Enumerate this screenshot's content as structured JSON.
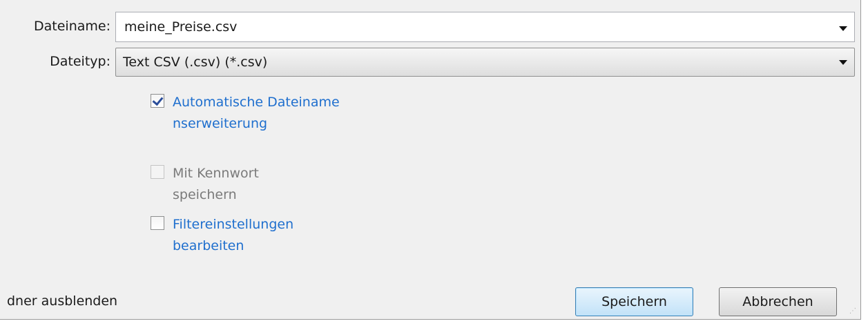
{
  "fields": {
    "filename_label": "Dateiname:",
    "filename_value": "meine_Preise.csv",
    "filetype_label": "Dateityp:",
    "filetype_value": "Text CSV (.csv) (*.csv)"
  },
  "options": {
    "auto_extension": {
      "label": "Automatische Dateinamenserweiterung",
      "checked": true
    },
    "save_with_password": {
      "label": "Mit Kennwort speichern",
      "checked": false,
      "enabled": false
    },
    "edit_filter_settings": {
      "label": "Filtereinstellungen bearbeiten",
      "checked": false
    }
  },
  "footer": {
    "hide_folders_label": "dner ausblenden",
    "save_label": "Speichern",
    "cancel_label": "Abbrechen"
  },
  "icons": {
    "dropdown": "chevron-down-icon",
    "checkbox_check": "checkmark-icon",
    "resize": "resize-grip-icon"
  },
  "colors": {
    "dialog_background": "#f0f0f0",
    "link_text": "#1f6fce",
    "disabled_text": "#7a7a7a",
    "primary_button_border": "#3c7fb1"
  }
}
